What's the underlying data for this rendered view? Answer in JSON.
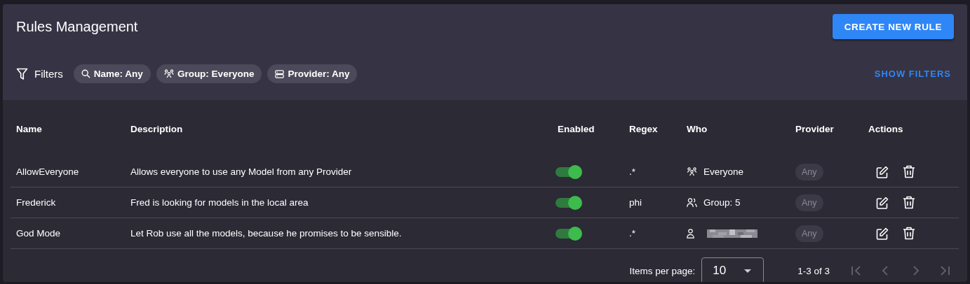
{
  "header": {
    "title": "Rules Management",
    "create_button": "CREATE NEW RULE"
  },
  "filters": {
    "label": "Filters",
    "chips": [
      {
        "kind": "search",
        "label": "Name: Any"
      },
      {
        "kind": "group",
        "label": "Group: Everyone"
      },
      {
        "kind": "provider",
        "label": "Provider: Any"
      }
    ],
    "show_button": "SHOW FILTERS"
  },
  "table": {
    "columns": [
      "Name",
      "Description",
      "Enabled",
      "Regex",
      "Who",
      "Provider",
      "Actions"
    ],
    "rows": [
      {
        "name": "AllowEveryone",
        "description": "Allows everyone to use any Model from any Provider",
        "enabled": true,
        "regex": ".*",
        "who": {
          "kind": "everyone",
          "label": "Everyone"
        },
        "provider": "Any"
      },
      {
        "name": "Frederick",
        "description": "Fred is looking for models in the local area",
        "enabled": true,
        "regex": "phi",
        "who": {
          "kind": "group",
          "label": "Group: 5"
        },
        "provider": "Any"
      },
      {
        "name": "God Mode",
        "description": "Let Rob use all the models, because he promises to be sensible.",
        "enabled": true,
        "regex": ".*",
        "who": {
          "kind": "user"
        },
        "provider": "Any"
      }
    ]
  },
  "pagination": {
    "items_per_page_label": "Items per page:",
    "items_per_page": "10",
    "range": "1-3 of 3"
  }
}
